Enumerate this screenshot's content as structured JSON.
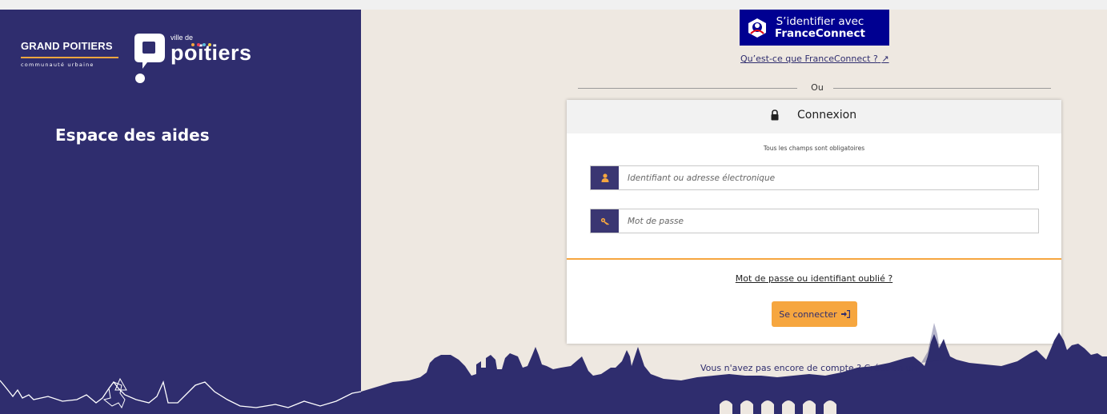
{
  "branding": {
    "grand_poitiers": "GRAND POITIERS",
    "communaute": "communauté urbaine",
    "ville_de": "ville de",
    "poitiers": "poitiers"
  },
  "sidebar": {
    "title": "Espace des aides"
  },
  "franceconnect": {
    "line1": "S’identifier avec",
    "line2": "FranceConnect",
    "help_link": "Qu’est-ce que FranceConnect ?"
  },
  "separator": "Ou",
  "login": {
    "title": "Connexion",
    "mandatory_note": "Tous les champs sont obligatoires",
    "username_placeholder": "Identifiant ou adresse électronique",
    "password_placeholder": "Mot de passe",
    "forgot_link": "Mot de passe ou identifiant oublié ?",
    "submit_label": "Se connecter"
  },
  "signup": {
    "text": "Vous n'avez pas encore de compte ?",
    "link": "Créez-en un"
  },
  "colors": {
    "brand_navy": "#2f2d6e",
    "accent_orange": "#f6a63f",
    "franceconnect_blue": "#000091",
    "background_beige": "#eee8e1"
  },
  "icons": [
    "franceconnect-logo-icon",
    "external-link-icon",
    "lock-icon",
    "user-icon",
    "key-icon",
    "sign-in-icon"
  ]
}
